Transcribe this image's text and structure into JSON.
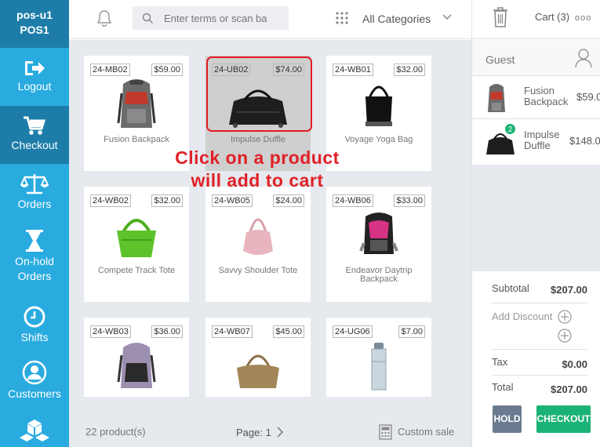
{
  "sidebar": {
    "user": "pos-u1",
    "terminal": "POS1",
    "items": [
      {
        "label": "Logout",
        "icon": "logout-icon"
      },
      {
        "label": "Checkout",
        "icon": "cart-icon"
      },
      {
        "label": "Orders",
        "icon": "scale-icon"
      },
      {
        "label": "On-hold Orders",
        "icon": "hourglass-icon"
      },
      {
        "label": "Shifts",
        "icon": "clock-icon"
      },
      {
        "label": "Customers",
        "icon": "user-icon"
      },
      {
        "label": "",
        "icon": "boxes-icon"
      }
    ],
    "colors": {
      "bg": "#29abe0",
      "active": "#1d7da8"
    }
  },
  "header": {
    "search_placeholder": "Enter terms or scan ba",
    "category": "All Categories"
  },
  "products": [
    {
      "sku": "24-MB02",
      "price": "$59.00",
      "name": "Fusion Backpack",
      "icon": "backpack-icon"
    },
    {
      "sku": "24-UB02",
      "price": "$74.00",
      "name": "Impulse Duffle",
      "icon": "duffle-icon",
      "selected": true
    },
    {
      "sku": "24-WB01",
      "price": "$32.00",
      "name": "Voyage Yoga Bag",
      "icon": "tote-icon"
    },
    {
      "sku": "24-WB02",
      "price": "$32.00",
      "name": "Compete Track Tote",
      "icon": "tote-icon"
    },
    {
      "sku": "24-WB05",
      "price": "$24.00",
      "name": "Savvy Shoulder Tote",
      "icon": "shoulder-bag-icon"
    },
    {
      "sku": "24-WB06",
      "price": "$33.00",
      "name": "Endeavor Daytrip Backpack",
      "icon": "backpack-icon"
    },
    {
      "sku": "24-WB03",
      "price": "$36.00",
      "name": "",
      "icon": "backpack-icon"
    },
    {
      "sku": "24-WB07",
      "price": "$45.00",
      "name": "",
      "icon": "handbag-icon"
    },
    {
      "sku": "24-UG06",
      "price": "$7.00",
      "name": "",
      "icon": "bottle-icon"
    }
  ],
  "callout": {
    "line1": "Click on a product",
    "line2": "will add to cart",
    "color": "#e02127"
  },
  "footer": {
    "count": "22 product(s)",
    "page": "Page: 1",
    "custom_sale": "Custom sale"
  },
  "cart": {
    "title": "Cart (3)",
    "more": "ooo",
    "customer": "Guest",
    "items": [
      {
        "name": "Fusion Backpack",
        "price": "$59.0",
        "qty_badge": ""
      },
      {
        "name": "Impulse Duffle",
        "price": "$148.0",
        "qty_badge": "2"
      }
    ],
    "subtotal_label": "Subtotal",
    "subtotal": "$207.00",
    "discount_label": "Add Discount",
    "tax_label": "Tax",
    "tax": "$0.00",
    "total_label": "Total",
    "total": "$207.00",
    "hold_label": "HOLD",
    "checkout_label": "CHECKOUT"
  }
}
